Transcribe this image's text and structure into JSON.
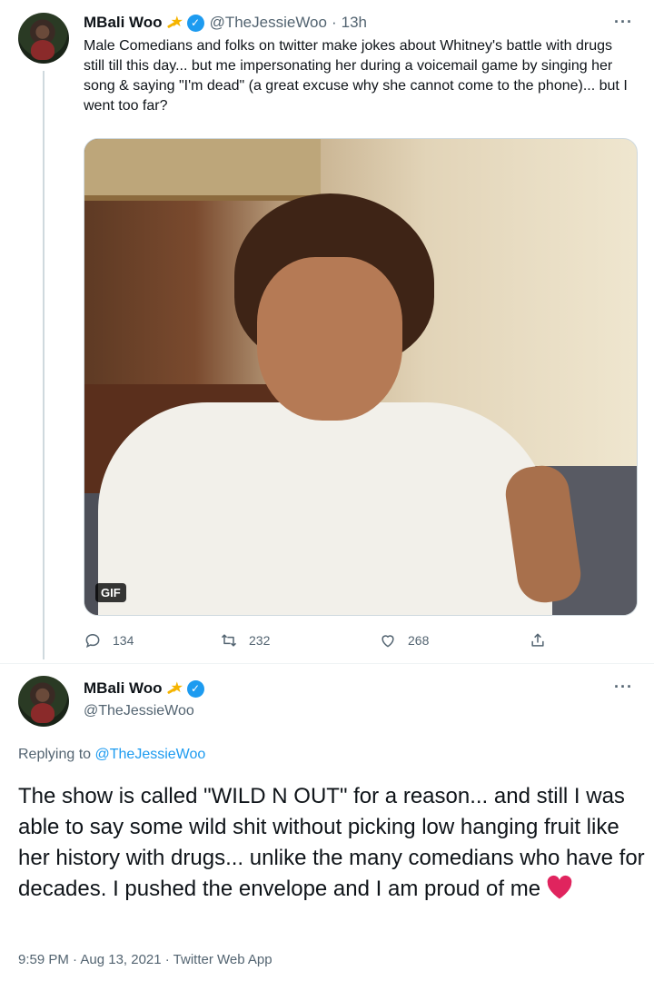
{
  "tweet": {
    "author_name": "MBali Woo",
    "author_handle": "@TheJessieWoo",
    "separator": "·",
    "time_ago": "13h",
    "more_label": "···",
    "text": "Male Comedians and folks on twitter make jokes about Whitney's battle with drugs still till this day... but me impersonating her during a voicemail game by singing her song & saying \"I'm dead\" (a great excuse why she cannot come to the phone)... but I went too far?",
    "media_badge": "GIF",
    "actions": {
      "replies": "134",
      "retweets": "232",
      "likes": "268"
    }
  },
  "reply": {
    "author_name": "MBali Woo",
    "author_handle": "@TheJessieWoo",
    "more_label": "···",
    "replying_prefix": "Replying to ",
    "replying_to": "@TheJessieWoo",
    "text": "The show is called \"WILD N OUT\" for a reason... and still I was able to say some wild shit without picking low hanging fruit like her history with drugs... unlike the many comedians who have for decades. I pushed the envelope and I am proud of me",
    "timestamp": "9:59 PM · Aug 13, 2021 · Twitter Web App"
  },
  "colors": {
    "verified": "#1d9bf0",
    "secondary_text": "#536471",
    "heart": "#e0245e",
    "link": "#1d9bf0"
  },
  "icons": [
    "reply-icon",
    "retweet-icon",
    "like-icon",
    "share-icon",
    "verified-badge-icon",
    "heart-emoji-icon",
    "shooting-star-emoji-icon"
  ]
}
